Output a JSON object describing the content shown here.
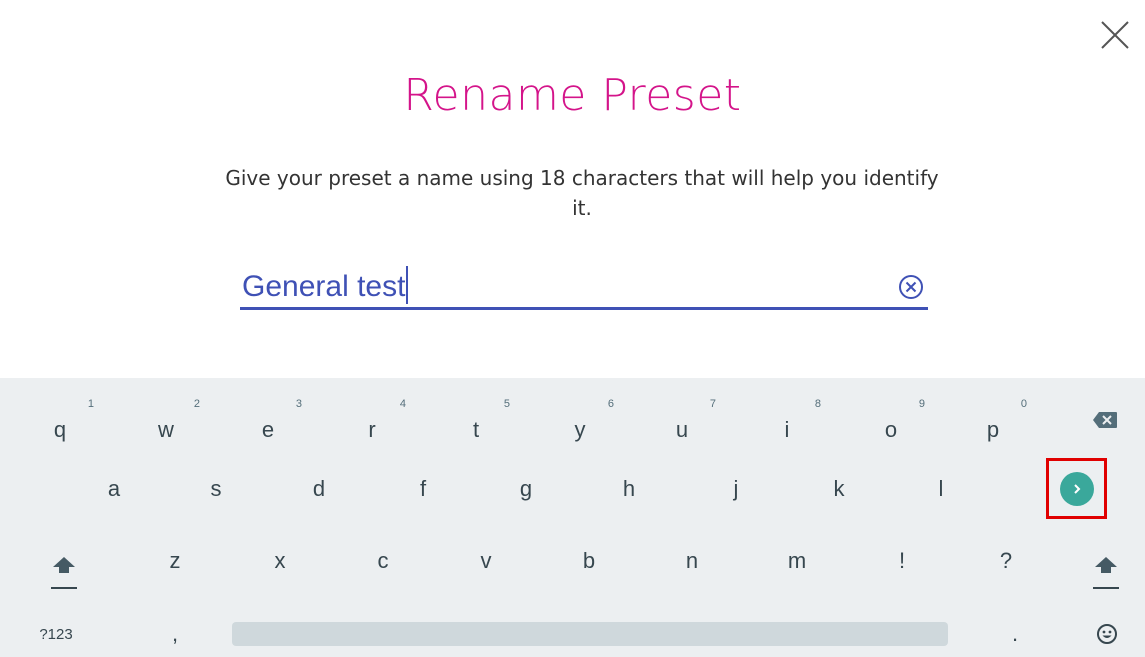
{
  "dialog": {
    "title": "Rename Preset",
    "description": "Give your preset a name using 18 characters that will help you identify it.",
    "input_value": "General test"
  },
  "keyboard": {
    "row1": [
      {
        "label": "q",
        "hint": "1"
      },
      {
        "label": "w",
        "hint": "2"
      },
      {
        "label": "e",
        "hint": "3"
      },
      {
        "label": "r",
        "hint": "4"
      },
      {
        "label": "t",
        "hint": "5"
      },
      {
        "label": "y",
        "hint": "6"
      },
      {
        "label": "u",
        "hint": "7"
      },
      {
        "label": "i",
        "hint": "8"
      },
      {
        "label": "o",
        "hint": "9"
      },
      {
        "label": "p",
        "hint": "0"
      }
    ],
    "row2": [
      "a",
      "s",
      "d",
      "f",
      "g",
      "h",
      "j",
      "k",
      "l"
    ],
    "row3": [
      "z",
      "x",
      "c",
      "v",
      "b",
      "n",
      "m",
      "!",
      "?"
    ],
    "row4": {
      "symbols": "?123",
      "comma": ",",
      "period": "."
    },
    "icons": {
      "backspace": "backspace-icon",
      "enter": "chevron-right-icon",
      "shift": "shift-icon",
      "emoji": "emoji-icon",
      "close": "close-icon",
      "clear": "clear-circle-icon"
    }
  },
  "colors": {
    "title": "#d4148a",
    "accent": "#3f51b5",
    "enter_key": "#3aa89b",
    "highlight": "#e00000",
    "keyboard_bg": "#eceff1"
  }
}
